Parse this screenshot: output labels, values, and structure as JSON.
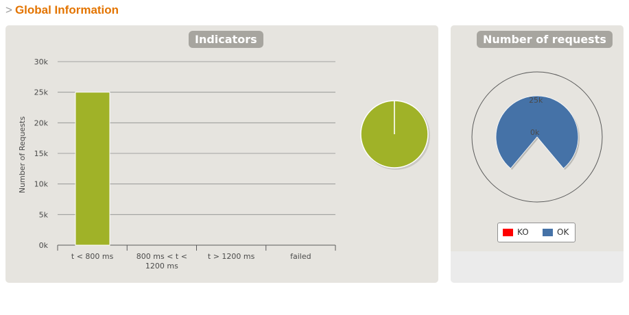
{
  "header": {
    "arrow": ">",
    "title": "Global Information"
  },
  "indicators": {
    "title": "Indicators",
    "chart_data": {
      "type": "bar",
      "ylabel": "Number of Requests",
      "ylim": [
        0,
        30000
      ],
      "yticks": [
        "0k",
        "5k",
        "10k",
        "15k",
        "20k",
        "25k",
        "30k"
      ],
      "categories": [
        [
          "t < 800 ms"
        ],
        [
          "800 ms < t <",
          "1200 ms"
        ],
        [
          "t > 1200 ms"
        ],
        [
          "failed"
        ]
      ],
      "values": [
        25000,
        0,
        0,
        0
      ],
      "colors": [
        "#a0b228",
        "#ffdd00",
        "#ff9916",
        "#ff0000"
      ],
      "grid": true
    },
    "pie": {
      "type": "pie",
      "values": [
        100
      ],
      "colors": [
        "#a0b228"
      ]
    }
  },
  "requests": {
    "title": "Number of requests",
    "chart_data": {
      "type": "gauge",
      "labels": [
        "25k",
        "0k"
      ],
      "series": [
        {
          "name": "KO",
          "value": 0,
          "color": "#ff0000"
        },
        {
          "name": "OK",
          "value": 25000,
          "color": "#4572a7"
        }
      ]
    }
  }
}
